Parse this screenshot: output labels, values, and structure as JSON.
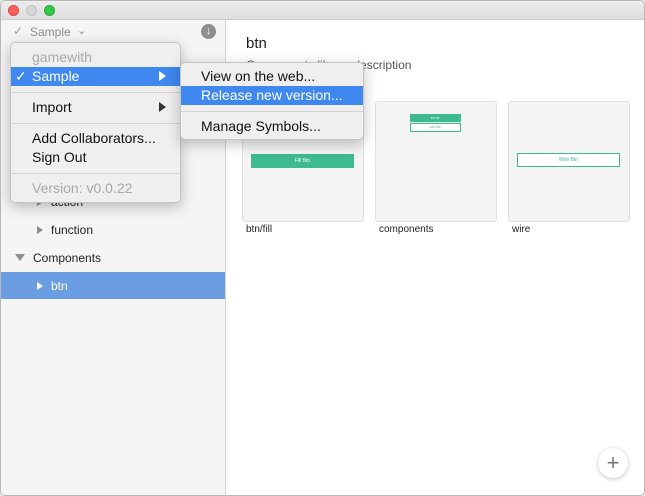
{
  "sidebar": {
    "project_label": "Sample",
    "check_glyph": "✓",
    "chevron_glyph": "⌄",
    "download_glyph": "↓",
    "tree": [
      {
        "label": "action",
        "expanded": false
      },
      {
        "label": "function",
        "expanded": false
      },
      {
        "label": "Components",
        "expanded": true
      },
      {
        "label": "btn",
        "expanded": false,
        "selected": true
      }
    ]
  },
  "main": {
    "title": "btn",
    "description": "Components library description",
    "cards": [
      {
        "label": "btn/fill",
        "preview_text": "Fill Btn"
      },
      {
        "label": "components",
        "preview_text_top": "Fill Btn",
        "preview_text_bottom": "Wire Btn"
      },
      {
        "label": "wire",
        "preview_text": "Wire Btn"
      }
    ],
    "add_glyph": "+"
  },
  "menu": {
    "items": {
      "gamewith": "gamewith",
      "sample": "Sample",
      "sample_check": "✓",
      "import": "Import",
      "add_collaborators": "Add Collaborators...",
      "sign_out": "Sign Out",
      "version": "Version: v0.0.22"
    }
  },
  "submenu": {
    "items": {
      "view_on_web": "View on the web...",
      "release_new_version": "Release new version...",
      "manage_symbols": "Manage Symbols..."
    }
  },
  "colors": {
    "accent": "#3dba8e",
    "selection": "#6a9de2",
    "menu_highlight": "#3f88f0"
  }
}
